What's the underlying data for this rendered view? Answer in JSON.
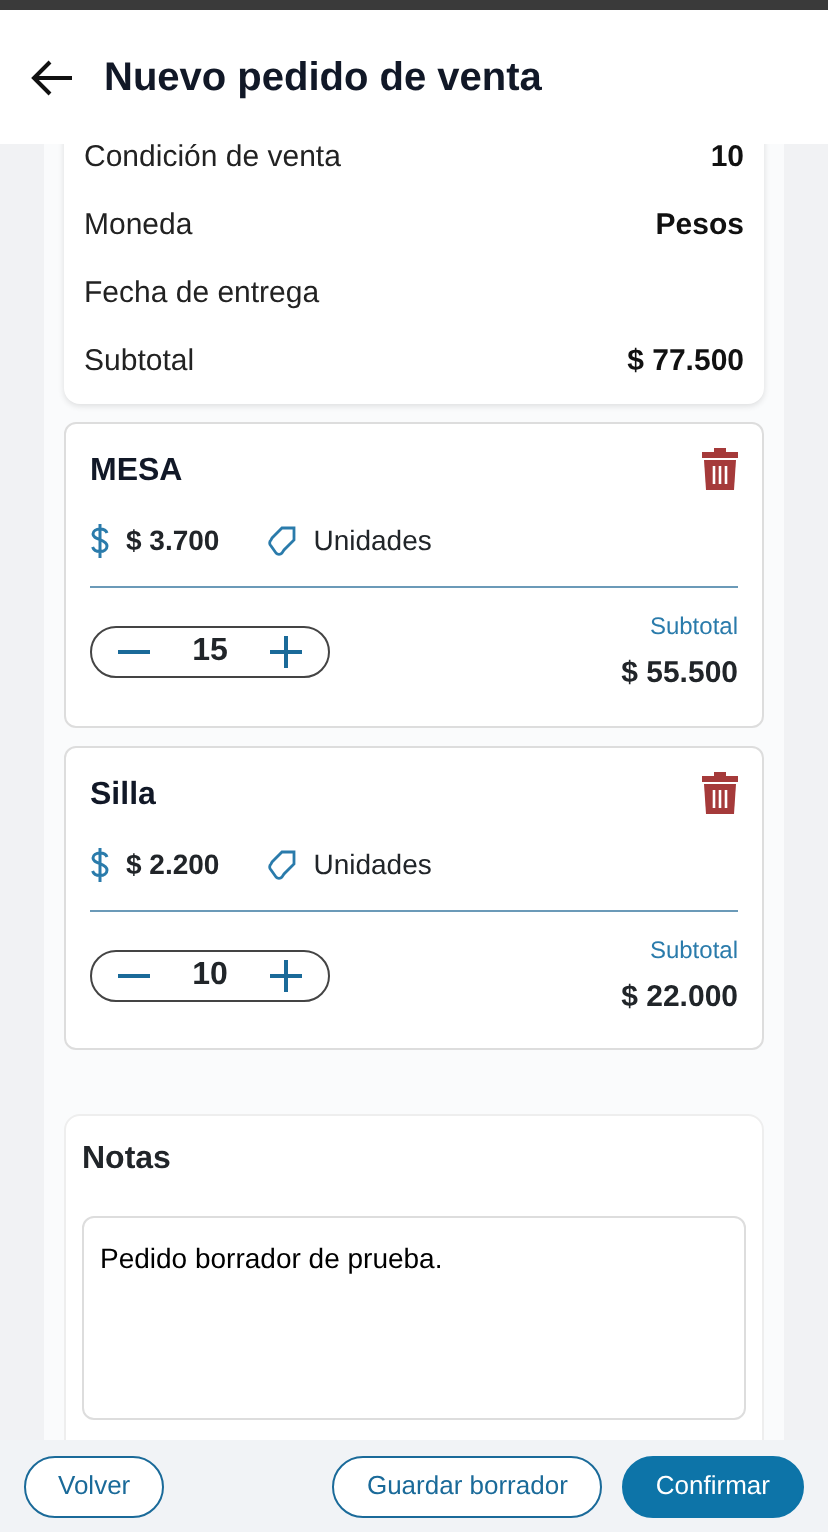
{
  "header": {
    "title": "Nuevo pedido de venta"
  },
  "summary": [
    {
      "label": "Condición de venta",
      "value": "10"
    },
    {
      "label": "Moneda",
      "value": "Pesos"
    },
    {
      "label": "Fecha de entrega"
    },
    {
      "label": "Subtotal",
      "value": "$ 77.500"
    }
  ],
  "items": [
    {
      "name": "MESA",
      "price": "$ 3.700",
      "unit": "Unidades",
      "quantity": "15",
      "subtotal_label": "Subtotal",
      "subtotal": "$ 55.500"
    },
    {
      "name": "Silla",
      "price": "$ 2.200",
      "unit": "Unidades",
      "quantity": "10",
      "subtotal_label": "Subtotal",
      "subtotal": "$ 22.000"
    }
  ],
  "notes": {
    "title": "Notas",
    "value": "Pedido borrador de prueba."
  },
  "buttons": [
    {
      "label": "Volver",
      "kind": "outline"
    },
    {
      "label": "Guardar borrador",
      "kind": "outline"
    },
    {
      "label": "Confirmar",
      "kind": "primary"
    }
  ]
}
